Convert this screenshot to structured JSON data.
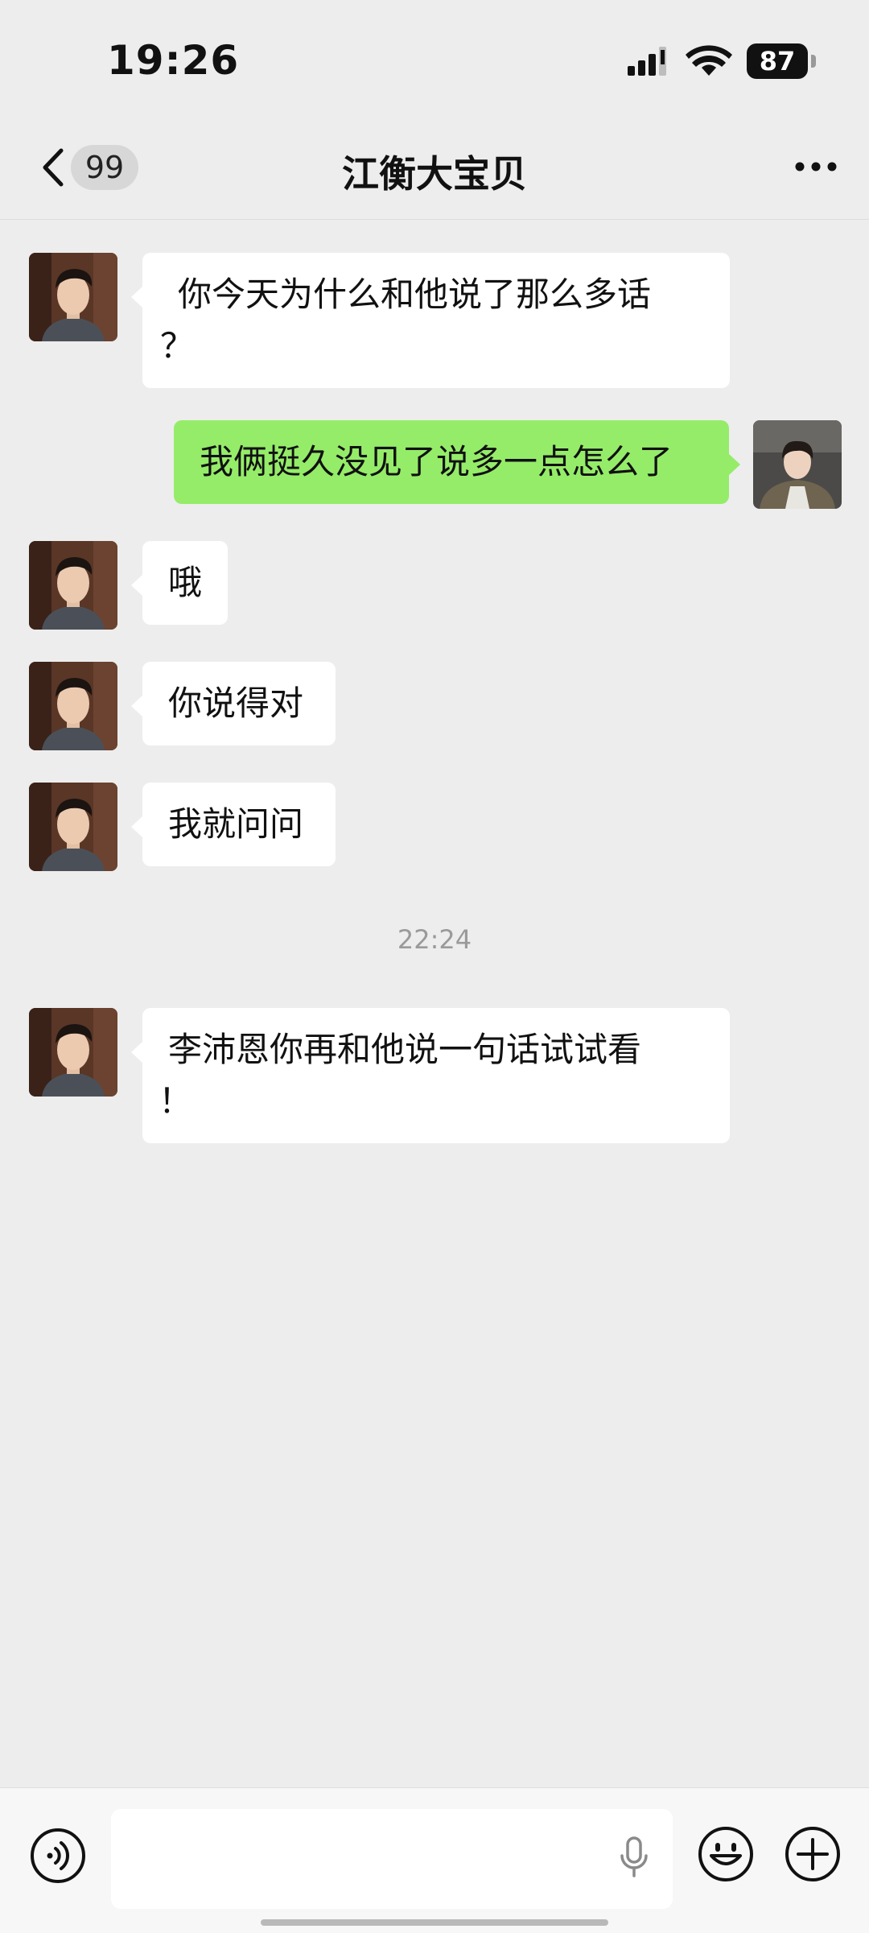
{
  "status": {
    "time": "19:26",
    "battery": "87"
  },
  "nav": {
    "back_badge": "99",
    "title": "江衡大宝贝"
  },
  "messages": [
    {
      "side": "left",
      "lines": [
        "你今天为什么和他说了那么多话",
        "？"
      ]
    },
    {
      "side": "right",
      "lines": [
        "我俩挺久没见了说多一点怎么了"
      ]
    },
    {
      "side": "left",
      "lines": [
        "哦"
      ]
    },
    {
      "side": "left",
      "lines": [
        "你说得对"
      ]
    },
    {
      "side": "left",
      "lines": [
        "我就问问"
      ]
    },
    {
      "side": "left",
      "lines": [
        "李沛恩你再和他说一句话试试看",
        "！"
      ]
    }
  ],
  "timestamp": "22:24",
  "colors": {
    "background": "#ededed",
    "bubble_self": "#95ec69",
    "bubble_other": "#ffffff"
  },
  "icons": [
    "back-chevron-icon",
    "more-icon",
    "voice-icon",
    "mic-icon",
    "emoji-icon",
    "plus-icon",
    "signal-icon",
    "wifi-icon"
  ]
}
